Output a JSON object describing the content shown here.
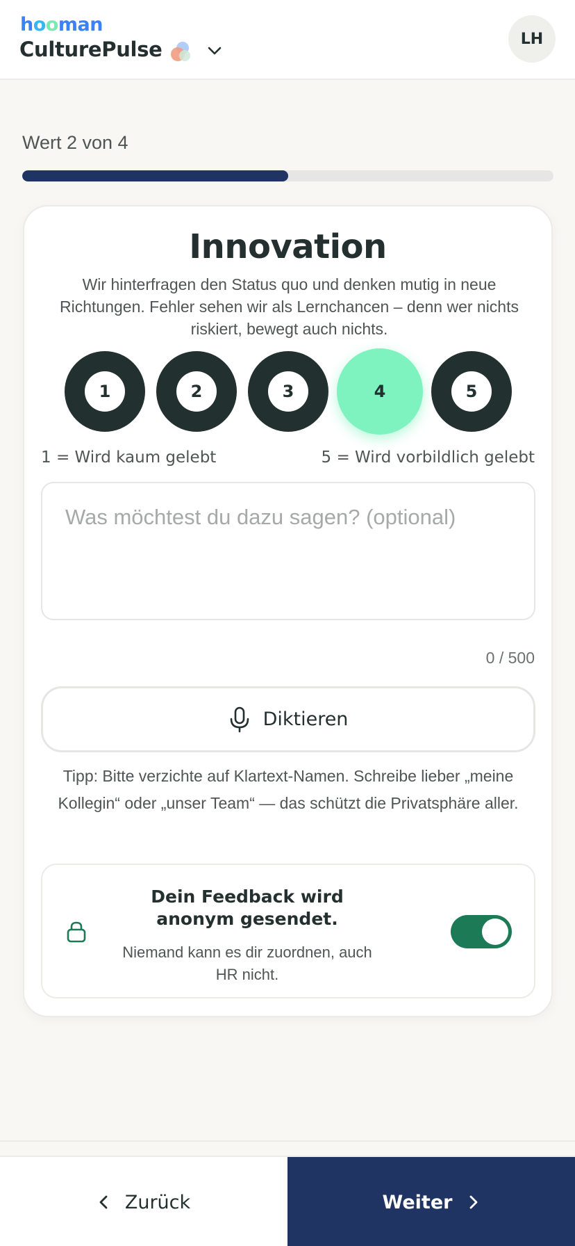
{
  "header": {
    "brand_letters": [
      "h",
      "o",
      "o",
      "m",
      "a",
      "n"
    ],
    "brand_colors": [
      "#3b82f6",
      "#38b6f0",
      "#7ee8b4",
      "#3b82f6",
      "#3b82f6",
      "#3b82f6"
    ],
    "app_name": "CulturePulse",
    "logo_icon": "colored-bubbles-logo",
    "dropdown_icon": "chevron-down-icon",
    "avatar_initials": "LH"
  },
  "progress": {
    "label": "Wert 2 von 4",
    "fraction": 0.5,
    "fill_color": "#1f3463"
  },
  "value": {
    "title": "Innovation",
    "description": "Wir hinterfragen den Status quo und denken mutig in neue Richtungen. Fehler sehen wir als Lernchancen – denn wer nichts riskiert, bewegt auch nichts."
  },
  "rating": {
    "options": [
      "1",
      "2",
      "3",
      "4",
      "5"
    ],
    "selected": "4",
    "selected_color": "#7ef3c0",
    "low_label": "1 = Wird kaum gelebt",
    "high_label": "5 = Wird vorbildlich gelebt"
  },
  "comment": {
    "placeholder": "Was möchtest du dazu sagen? (optional)",
    "value": "",
    "count": "0 / 500"
  },
  "dictate": {
    "icon": "microphone-icon",
    "label": "Diktieren"
  },
  "tip": "Tipp: Bitte verzichte auf Klartext-Namen. Schreibe lieber „meine Kollegin“ oder „unser Team“ — das schützt die Privatsphäre aller.",
  "anonymous": {
    "icon": "lock-icon",
    "title": "Dein Feedback wird anonym gesendet.",
    "subtitle": "Niemand kann es dir zuordnen, auch HR nicht.",
    "enabled": true,
    "toggle_color": "#1c7a57"
  },
  "footer": {
    "back_label": "Zurück",
    "next_label": "Weiter",
    "next_color": "#1f3463"
  }
}
